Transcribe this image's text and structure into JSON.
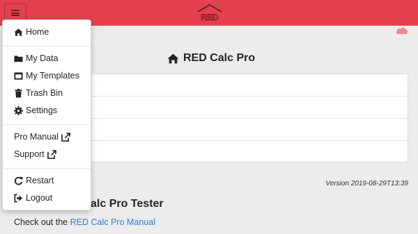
{
  "navbar": {
    "logo_text": "RED",
    "accent_color": "#e4404d"
  },
  "main": {
    "title": "RED Calc Pro",
    "version": "Version 2019-08-29T13:39",
    "tester_heading": "alc Pro Tester",
    "checkout_prefix": "Check out the ",
    "checkout_link": "RED Calc Pro Manual"
  },
  "menu": {
    "items": [
      {
        "label": "Home",
        "icon": "home-icon"
      },
      {
        "label": "My Data",
        "icon": "folder-icon"
      },
      {
        "label": "My Templates",
        "icon": "window-icon"
      },
      {
        "label": "Trash Bin",
        "icon": "trash-icon"
      },
      {
        "label": "Settings",
        "icon": "gear-icon"
      },
      {
        "label": "Pro Manual",
        "icon": "external-link-icon"
      },
      {
        "label": "Support",
        "icon": "external-link-icon"
      },
      {
        "label": "Restart",
        "icon": "restart-icon"
      },
      {
        "label": "Logout",
        "icon": "logout-icon"
      }
    ]
  },
  "colors": {
    "link": "#2d7fd3",
    "cloud": "#e88a8f"
  }
}
